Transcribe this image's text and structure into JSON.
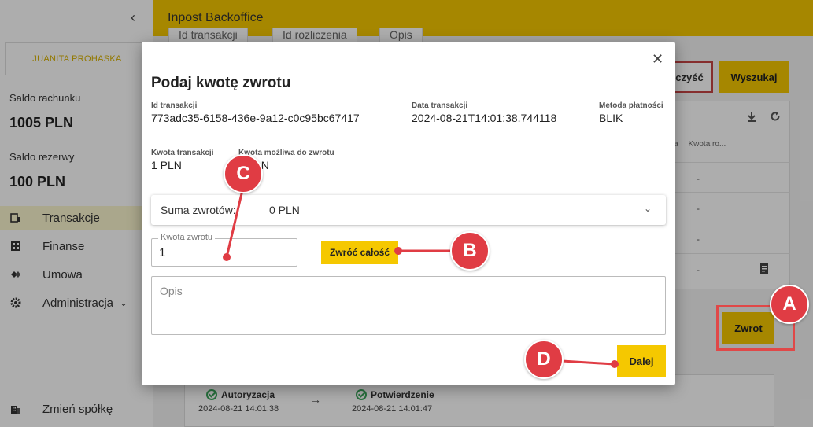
{
  "app": {
    "title": "Inpost Backoffice"
  },
  "sidebar": {
    "user": "JUANITA PROHASKA",
    "account_balance_label": "Saldo rachunku",
    "account_balance": "1005 PLN",
    "reserve_balance_label": "Saldo rezerwy",
    "reserve_balance": "100 PLN",
    "items": [
      {
        "label": "Transakcje",
        "icon": "transactions-icon",
        "active": true
      },
      {
        "label": "Finanse",
        "icon": "calculator-icon"
      },
      {
        "label": "Umowa",
        "icon": "handshake-icon"
      },
      {
        "label": "Administracja",
        "icon": "gear-icon"
      }
    ],
    "change_company": "Zmień spółkę"
  },
  "background": {
    "filter_tabs": [
      "Id transakcji",
      "Id rozliczenia",
      "Opis"
    ],
    "clear_label": "czyść",
    "search_label": "Wyszukaj",
    "table_headers": [
      "ona",
      "Kwota ro..."
    ],
    "table_cells": [
      "-",
      "-",
      "-",
      "-"
    ],
    "refund_label": "Zwrot",
    "timeline": [
      {
        "label": "Autoryzacja",
        "date": "2024-08-21 14:01:38"
      },
      {
        "label": "Potwierdzenie",
        "date": "2024-08-21 14:01:47"
      }
    ]
  },
  "modal": {
    "title": "Podaj kwotę zwrotu",
    "transaction_id_label": "Id transakcji",
    "transaction_id": "773adc35-6158-436e-9a12-c0c95bc67417",
    "transaction_date_label": "Data transakcji",
    "transaction_date": "2024-08-21T14:01:38.744118",
    "payment_method_label": "Metoda płatności",
    "payment_method": "BLIK",
    "transaction_amount_label": "Kwota transakcji",
    "transaction_amount": "1 PLN",
    "refundable_amount_label": "Kwota możliwa do zwrotu",
    "refundable_amount": "1 PLN",
    "refund_sum_label": "Suma zwrotów:",
    "refund_sum": "0 PLN",
    "amount_field_label": "Kwota zwrotu",
    "amount_value": "1",
    "full_refund_label": "Zwróć całość",
    "description_placeholder": "Opis",
    "next_label": "Dalej"
  },
  "annotations": {
    "a": "A",
    "b": "B",
    "c": "C",
    "d": "D"
  },
  "colors": {
    "accent": "#f5c800",
    "marker": "#e03c44",
    "success": "#3aa55b"
  }
}
